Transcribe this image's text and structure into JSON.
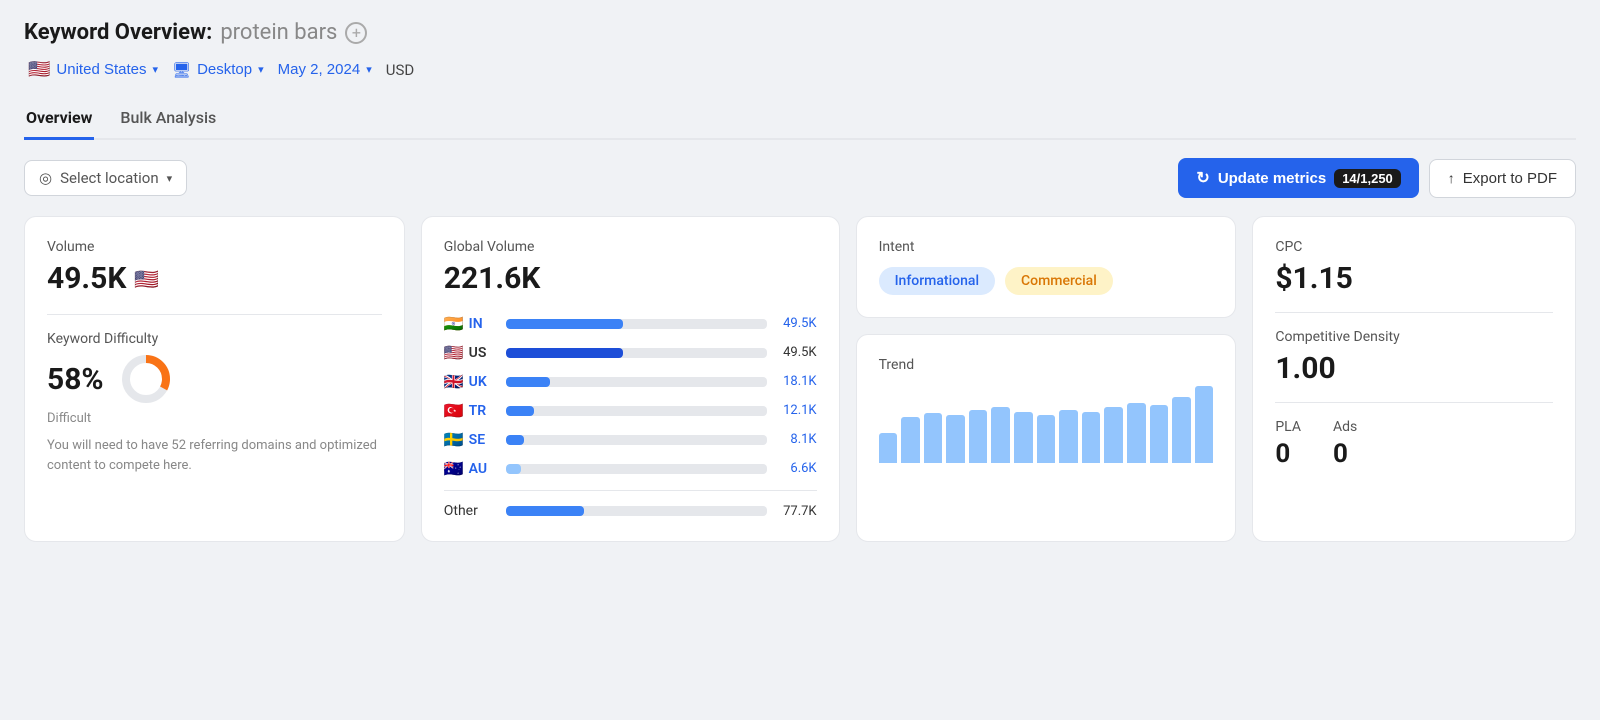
{
  "header": {
    "title_keyword": "Keyword Overview:",
    "title_query": "protein bars",
    "add_icon": "+"
  },
  "filter_bar": {
    "location": "United States",
    "location_flag": "🇺🇸",
    "device": "Desktop",
    "date": "May 2, 2024",
    "currency": "USD",
    "chevron": "▾",
    "device_icon": "🖥"
  },
  "tabs": [
    {
      "label": "Overview",
      "active": true
    },
    {
      "label": "Bulk Analysis",
      "active": false
    }
  ],
  "toolbar": {
    "select_location_label": "Select location",
    "update_metrics_label": "Update metrics",
    "update_count": "14/1,250",
    "export_label": "Export to PDF"
  },
  "cards": {
    "volume": {
      "label": "Volume",
      "value": "49.5K",
      "flag": "🇺🇸",
      "kd_label": "Keyword Difficulty",
      "kd_percent": "58%",
      "kd_difficulty": "Difficult",
      "kd_description": "You will need to have 52 referring domains and optimized content to compete here.",
      "donut_filled": 58,
      "donut_empty": 42
    },
    "global_volume": {
      "label": "Global Volume",
      "value": "221.6K",
      "countries": [
        {
          "flag": "🇮🇳",
          "code": "IN",
          "value": "49.5K",
          "bar_pct": 45,
          "color": "#3b82f6",
          "text_color": "#2563eb"
        },
        {
          "flag": "🇺🇸",
          "code": "US",
          "value": "49.5K",
          "bar_pct": 45,
          "color": "#1d4ed8",
          "text_color": "#1a1a1a"
        },
        {
          "flag": "🇬🇧",
          "code": "UK",
          "value": "18.1K",
          "bar_pct": 17,
          "color": "#3b82f6",
          "text_color": "#2563eb"
        },
        {
          "flag": "🇹🇷",
          "code": "TR",
          "value": "12.1K",
          "bar_pct": 11,
          "color": "#3b82f6",
          "text_color": "#2563eb"
        },
        {
          "flag": "🇸🇪",
          "code": "SE",
          "value": "8.1K",
          "bar_pct": 7,
          "color": "#3b82f6",
          "text_color": "#2563eb"
        },
        {
          "flag": "🇦🇺",
          "code": "AU",
          "value": "6.6K",
          "bar_pct": 6,
          "color": "#93c5fd",
          "text_color": "#2563eb"
        }
      ],
      "other_label": "Other",
      "other_value": "77.7K",
      "other_bar_pct": 30
    },
    "intent": {
      "label": "Intent",
      "tags": [
        {
          "label": "Informational",
          "type": "info"
        },
        {
          "label": "Commercial",
          "type": "commercial"
        }
      ]
    },
    "trend": {
      "label": "Trend",
      "bars": [
        30,
        45,
        50,
        48,
        52,
        55,
        50,
        48,
        52,
        50,
        55,
        60,
        58,
        65,
        75
      ]
    },
    "cpc": {
      "label": "CPC",
      "value": "$1.15",
      "comp_density_label": "Competitive Density",
      "comp_density_value": "1.00",
      "pla_label": "PLA",
      "pla_value": "0",
      "ads_label": "Ads",
      "ads_value": "0"
    }
  },
  "icons": {
    "location_pin": "◎",
    "chevron_down": "▾",
    "refresh": "↻",
    "export_arrow": "↑",
    "monitor": "🖥"
  }
}
